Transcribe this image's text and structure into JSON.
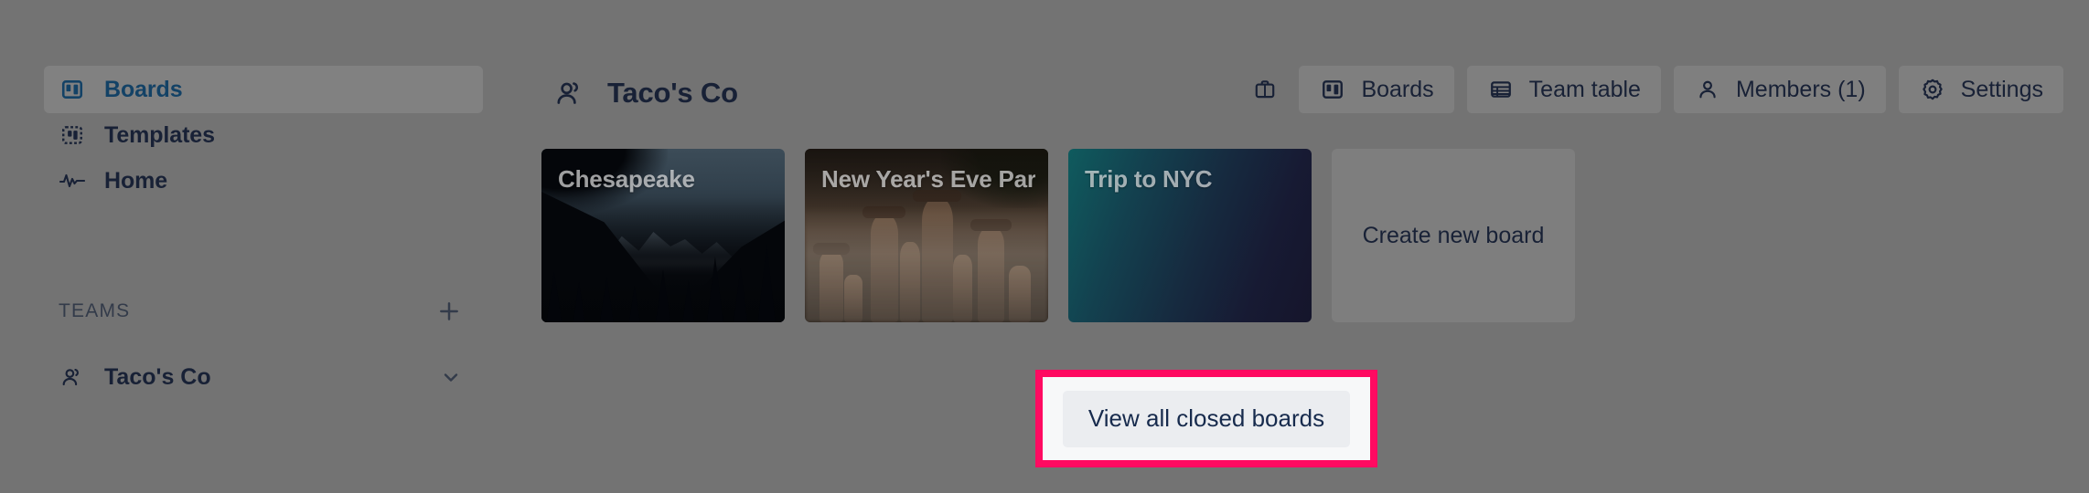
{
  "theme": {
    "page_background": "#737373",
    "sidebar_active_text": "#134266",
    "text_primary": "#182136",
    "highlight_border": "#ff0a61",
    "highlight_fill": "#f7f8f9",
    "button_fill": "#ebedf0"
  },
  "sidebar": {
    "items": [
      {
        "label": "Boards",
        "icon": "board-icon",
        "active": true
      },
      {
        "label": "Templates",
        "icon": "templates-icon",
        "active": false
      },
      {
        "label": "Home",
        "icon": "activity-icon",
        "active": false
      }
    ],
    "teams_section": {
      "title": "TEAMS",
      "add_icon": "plus-icon",
      "teams": [
        {
          "label": "Taco's Co",
          "icon": "people-icon",
          "chevron": "chevron-down-icon"
        }
      ]
    }
  },
  "header": {
    "team_name": "Taco's Co",
    "team_icon": "people-icon",
    "briefcase_icon": "briefcase-icon",
    "tabs": [
      {
        "label": "Boards",
        "icon": "board-icon",
        "active": true
      },
      {
        "label": "Team table",
        "icon": "table-icon",
        "active": false
      },
      {
        "label": "Members (1)",
        "icon": "person-icon",
        "active": false
      },
      {
        "label": "Settings",
        "icon": "gear-icon",
        "active": false
      }
    ]
  },
  "main": {
    "boards": [
      {
        "title": "Chesapeake",
        "background": "photo-mountains-forest"
      },
      {
        "title": "New Year's Eve Party",
        "background": "photo-rock-spires-mist"
      },
      {
        "title": "Trip to NYC",
        "background": "gradient-teal-navy"
      }
    ],
    "create_board_label": "Create new board",
    "closed_boards_label": "View all closed boards"
  }
}
